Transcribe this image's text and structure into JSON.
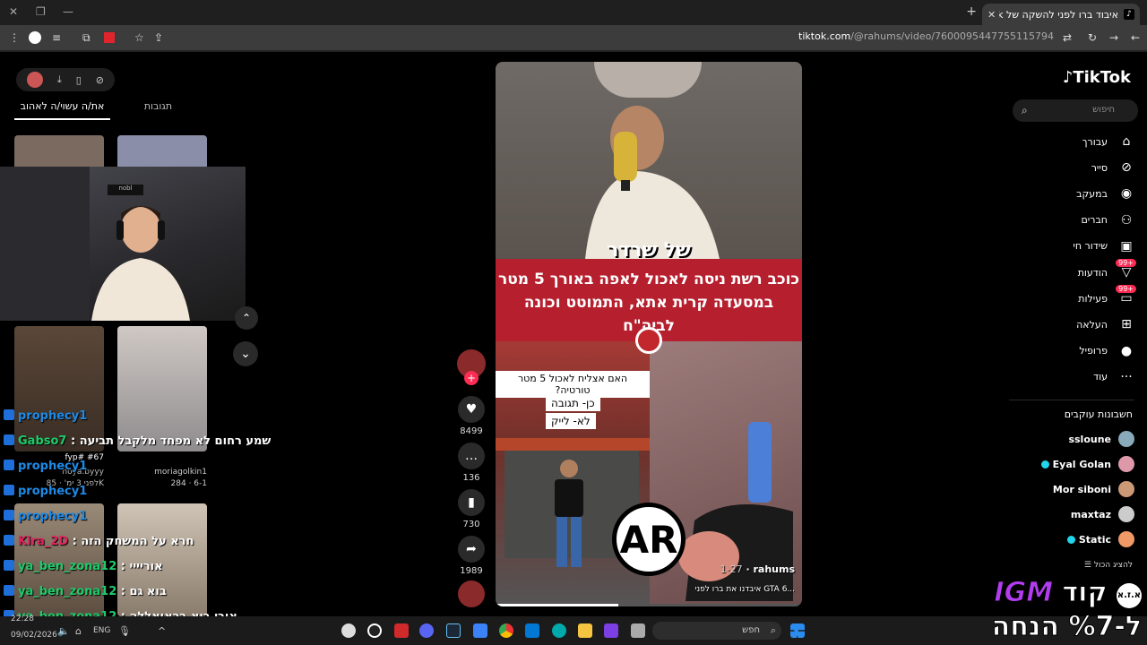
{
  "browser": {
    "tab_title": "איבוד ברו לפני להשקה של Tok",
    "url_host": "tiktok.com",
    "url_path": "/@rahums/video/7600095447755115794"
  },
  "left_panel": {
    "tab_liked": "את/ה עשוי/ה לאהוב",
    "tab_tags": "תגובות",
    "thumb_caption": "fyp# #67",
    "thumb_user": "noya.byyy",
    "thumb_meta": "לפני 3 ימ' · 85K",
    "thumb2_user": "moriagolkin1",
    "thumb2_meta": "284 · 6-1"
  },
  "chat": [
    {
      "user": "prophecy1",
      "msg": "",
      "color": "#1e8ae6"
    },
    {
      "user": "Gabso7",
      "msg": "שמע רחום לא מפחד מלקבל תביעה",
      "color": "#1ecb6a"
    },
    {
      "user": "prophecy1",
      "msg": "",
      "color": "#1e8ae6"
    },
    {
      "user": "prophecy1",
      "msg": "",
      "color": "#1e8ae6"
    },
    {
      "user": "prophecy1",
      "msg": "",
      "color": "#1e8ae6"
    },
    {
      "user": "Kira_2D",
      "msg": "חרא על המשחק הזה",
      "color": "#e0245e"
    },
    {
      "user": "ya_ben_zona12",
      "msg": "אוריייי",
      "color": "#1ecb6a"
    },
    {
      "user": "ya_ben_zona12",
      "msg": "בוא גם",
      "color": "#1ecb6a"
    },
    {
      "user": "ya_ben_zona12",
      "msg": "אורי בוא בראואללה",
      "color": "#1ecb6a"
    }
  ],
  "video": {
    "overlay_title": "של שרדר",
    "headline_1": "כוכב רשת ניסה לאכול לאפה באורך 5 מטר",
    "headline_2": "במסעדה קרית אתא, התמוטט וכונה לביה\"ח",
    "poll_question": "האם אצליח לאכול 5 מטר טורטיה?",
    "poll_yes": "כן- תגובה",
    "poll_no": "לא- לייק",
    "logo_text": "AR",
    "author": "rahums",
    "date": "1-27",
    "caption": "איבדנו את ברו לפני GTA 6..."
  },
  "actions": {
    "likes": "8499",
    "comments": "136",
    "saves": "730",
    "shares": "1989"
  },
  "sidebar": {
    "logo": "TikTok",
    "search_placeholder": "חיפוש",
    "nav": [
      {
        "label": "עבורך",
        "icon": "home-icon"
      },
      {
        "label": "סייר",
        "icon": "compass-icon"
      },
      {
        "label": "במעקב",
        "icon": "following-icon"
      },
      {
        "label": "חברים",
        "icon": "friends-icon"
      },
      {
        "label": "שידור חי",
        "icon": "live-icon"
      },
      {
        "label": "הודעות",
        "icon": "inbox-icon",
        "badge": "99+"
      },
      {
        "label": "פעילות",
        "icon": "activity-icon",
        "badge": "99+"
      },
      {
        "label": "העלאה",
        "icon": "upload-icon"
      },
      {
        "label": "פרופיל",
        "icon": "profile-icon"
      },
      {
        "label": "עוד",
        "icon": "more-icon"
      }
    ],
    "following_header": "חשבונות עוקבים",
    "following": [
      "ssloune",
      "Eyal Golan",
      "Mor siboni",
      "maxtaz",
      "Static"
    ],
    "show_all": "להציג הכול"
  },
  "taskbar": {
    "time": "22:28",
    "date": "09/02/2026",
    "lang": "ENG",
    "search": "חפש"
  },
  "promo": {
    "line1_word": "קוד",
    "line1_brand": "IGM",
    "badge": "א.ז.א",
    "line2": "ל-%7 הנחה"
  }
}
